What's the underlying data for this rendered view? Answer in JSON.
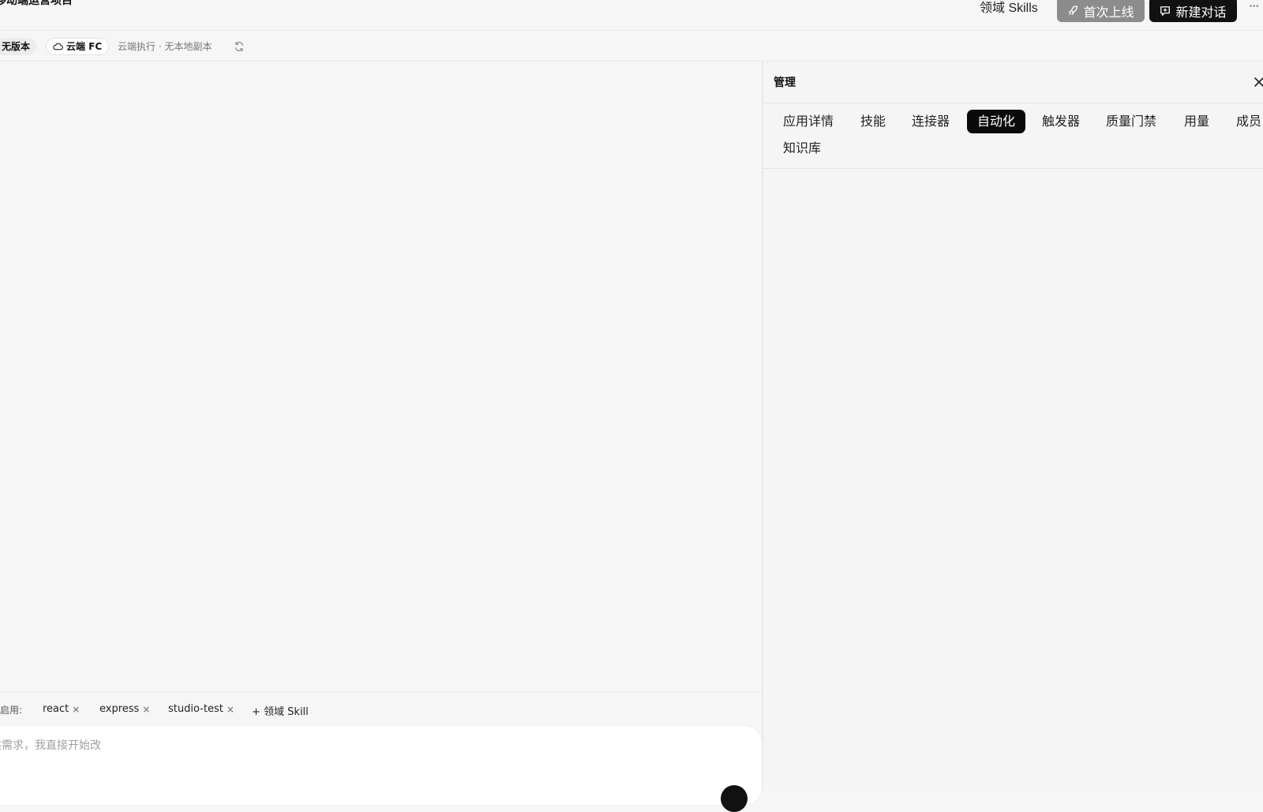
{
  "header": {
    "project_title": "移动端运营项目",
    "skills_link": "领域 Skills",
    "launch_button": "首次上线",
    "new_chat_button": "新建对话",
    "more_label": "···"
  },
  "subbar": {
    "version_chip": "无版本",
    "cloud_chip": "云端 FC",
    "execution_desc": "云端执行 · 无本地副本"
  },
  "panel": {
    "title": "管理",
    "tabs": [
      {
        "label": "应用详情"
      },
      {
        "label": "技能"
      },
      {
        "label": "连接器"
      },
      {
        "label": "自动化"
      },
      {
        "label": "触发器"
      },
      {
        "label": "质量门禁"
      },
      {
        "label": "用量"
      },
      {
        "label": "成员"
      },
      {
        "label": "知识库"
      }
    ],
    "active_tab": "自动化"
  },
  "skills_bar": {
    "label": "启用:",
    "tags": [
      {
        "label": "react"
      },
      {
        "label": "express"
      },
      {
        "label": "studio-test"
      }
    ],
    "add_label": "+ 领域 Skill",
    "remove_glyph": "×"
  },
  "composer": {
    "placeholder": "描述需求，我直接开始改"
  },
  "colors": {
    "accent_dark": "#111111",
    "launch_gray": "#8c8c8c",
    "background": "#f6f6f6"
  }
}
